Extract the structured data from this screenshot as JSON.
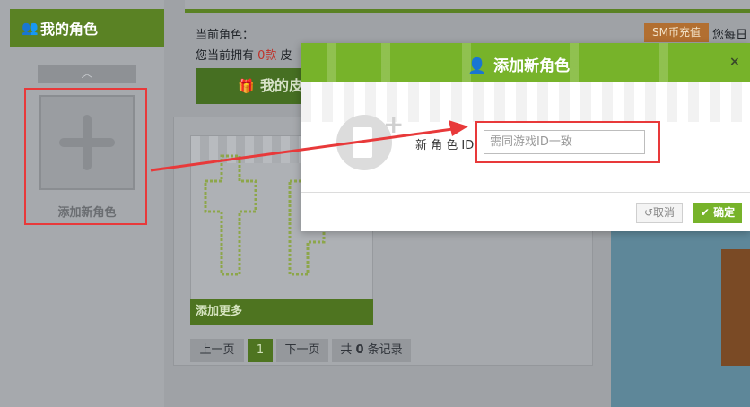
{
  "sidebar": {
    "title": "我的角色",
    "title_icon": "users-icon",
    "scroll_up_icon": "chevron-up-icon",
    "add_tile_icon": "plus-icon",
    "add_tile_label": "添加新角色"
  },
  "header": {
    "current_role_label": "当前角色：",
    "owned_prefix": "您当前拥有 ",
    "owned_count": "0款",
    "owned_suffix": " 皮",
    "sm_recharge": "SM币充值",
    "daily_text": "您每日",
    "my_button_icon": "gift-icon",
    "my_button_label": "我的皮"
  },
  "panel": {
    "add_more_label": "添加更多",
    "pagination": {
      "prev": "上一页",
      "current": "1",
      "next": "下一页",
      "total_prefix": "共 ",
      "total_count": "0",
      "total_suffix": " 条记录"
    }
  },
  "modal": {
    "title": "添加新角色",
    "title_icon": "user-icon",
    "close": "×",
    "id_label": "新 角 色 ID:",
    "id_placeholder": "需同游戏ID一致",
    "id_value": "",
    "cancel_label": "取消",
    "cancel_icon": "undo-icon",
    "ok_label": "确定",
    "ok_icon": "check-icon"
  },
  "colors": {
    "accent_green": "#77b32a",
    "dark_green": "#5a8224",
    "highlight_red": "#e8393a",
    "recharge_orange": "#b26f31",
    "count_red": "#c0332b"
  }
}
